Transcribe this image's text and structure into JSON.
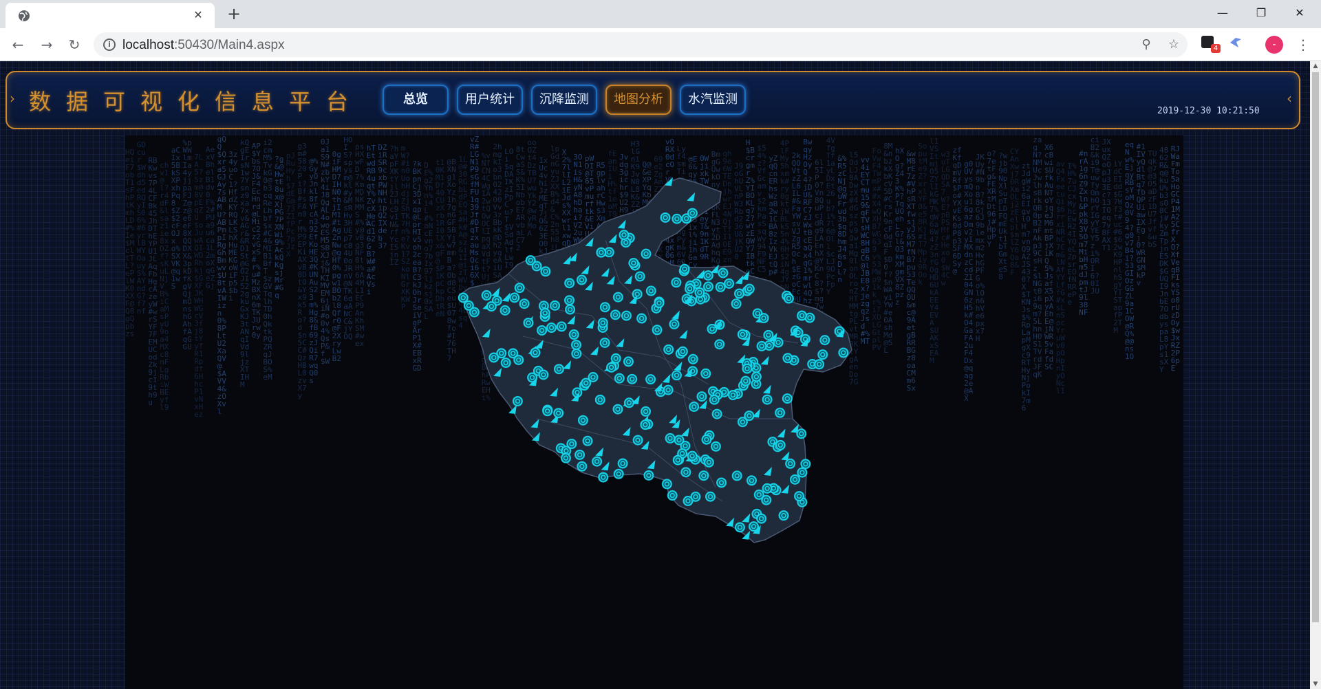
{
  "browser": {
    "tab_title": "",
    "new_tab_symbol": "+",
    "url_host": "localhost",
    "url_path": ":50430/Main4.aspx",
    "extension_badge": "4",
    "avatar_initial": "-"
  },
  "header": {
    "title": "数据可视化信息平台",
    "nav": [
      "总览",
      "用户统计",
      "沉降监测",
      "地图分析",
      "水汽监测"
    ],
    "active_nav_index": 3,
    "datetime": "2019-12-30 10:21:50"
  },
  "colors": {
    "title_gold": "#d5912e",
    "nav_blue": "#1d6fc2",
    "marker_cyan": "#17d6ec",
    "map_fill": "#1f2a3b",
    "rain_blue": "#2c4f86"
  },
  "icons": {
    "favicon": "globe-icon",
    "close": "close-icon",
    "back": "back-arrow-icon",
    "forward": "forward-arrow-icon",
    "reload": "reload-icon",
    "info": "info-icon",
    "zoom": "zoom-icon",
    "bookmark": "star-icon",
    "menu": "kebab-menu-icon"
  }
}
